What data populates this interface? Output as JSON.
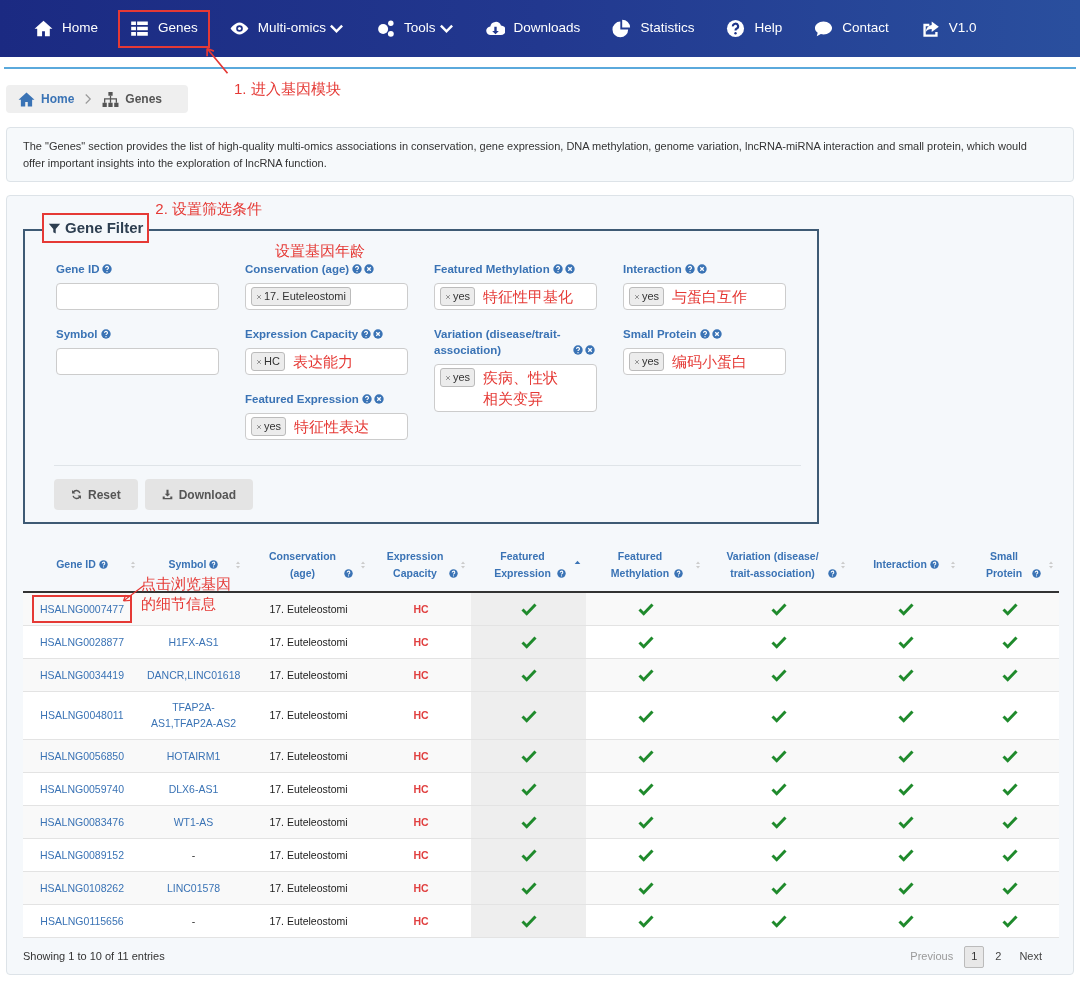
{
  "nav": {
    "items": [
      {
        "label": "Home",
        "dropdown": false,
        "highlighted": false
      },
      {
        "label": "Genes",
        "dropdown": false,
        "highlighted": true,
        "annotation": "1. 进入基因模块"
      },
      {
        "label": "Multi-omics",
        "dropdown": true,
        "highlighted": false
      },
      {
        "label": "Tools",
        "dropdown": true,
        "highlighted": false
      },
      {
        "label": "Downloads",
        "dropdown": false,
        "highlighted": false
      },
      {
        "label": "Statistics",
        "dropdown": false,
        "highlighted": false
      },
      {
        "label": "Help",
        "dropdown": false,
        "highlighted": false
      },
      {
        "label": "Contact",
        "dropdown": false,
        "highlighted": false
      },
      {
        "label": "V1.0",
        "dropdown": false,
        "highlighted": false
      }
    ]
  },
  "breadcrumb": [
    {
      "label": "Home"
    },
    {
      "label": "Genes"
    }
  ],
  "description": "The \"Genes\" section provides the list of high-quality multi-omics associations in conservation, gene expression, DNA methylation, genome variation, lncRNA-miRNA interaction and small protein, which would offer important insights into the exploration of lncRNA function.",
  "filter": {
    "title": "Gene Filter",
    "highlighted": true,
    "annotation": "2. 设置筛选条件",
    "columns": [
      [
        {
          "label": "Gene ID",
          "kind": "text",
          "clearable": false
        },
        {
          "label": "Symbol",
          "kind": "text",
          "clearable": false
        }
      ],
      [
        {
          "label": "Conservation (age)",
          "kind": "tags",
          "clearable": true,
          "tags": [
            "17. Euteleostomi"
          ],
          "annotation": "设置基因年龄"
        },
        {
          "label": "Expression Capacity",
          "kind": "tags",
          "clearable": true,
          "tags": [
            "HC"
          ],
          "note": "表达能力"
        },
        {
          "label": "Featured Expression",
          "kind": "tags",
          "clearable": true,
          "tags": [
            "yes"
          ],
          "note": "特征性表达"
        }
      ],
      [
        {
          "label": "Featured Methylation",
          "kind": "tags",
          "clearable": true,
          "tags": [
            "yes"
          ],
          "note": "特征性甲基化"
        },
        {
          "label": "Variation (disease/trait-association)",
          "kind": "tags",
          "clearable": true,
          "tags": [
            "yes"
          ],
          "note": "疾病、性状相关变异"
        }
      ],
      [
        {
          "label": "Interaction",
          "kind": "tags",
          "clearable": true,
          "tags": [
            "yes"
          ],
          "note": "与蛋白互作"
        },
        {
          "label": "Small Protein",
          "kind": "tags",
          "clearable": true,
          "tags": [
            "yes"
          ],
          "note": "编码小蛋白"
        }
      ]
    ],
    "buttons": [
      {
        "label": "Reset"
      },
      {
        "label": "Download"
      }
    ]
  },
  "table": {
    "columns": [
      {
        "label": "Gene ID",
        "sorted": false
      },
      {
        "label": "Symbol",
        "sorted": false
      },
      {
        "label": "Conservation (age)",
        "sorted": false
      },
      {
        "label": "Expression Capacity",
        "sorted": false
      },
      {
        "label": "Featured Expression",
        "sorted": true
      },
      {
        "label": "Featured Methylation",
        "sorted": false
      },
      {
        "label": "Variation (disease/ trait-association)",
        "sorted": false
      },
      {
        "label": "Interaction",
        "sorted": false
      },
      {
        "label": "Small Protein",
        "sorted": false
      }
    ],
    "rows": [
      {
        "gene_id": "HSALNG0007477",
        "highlighted": true,
        "annotation": "点击浏览基因的细节信息",
        "conservation": "17. Euteleostomi",
        "capacity": "HC",
        "featured_expression": true,
        "featured_methylation": true,
        "variation": true,
        "interaction": true,
        "small_protein": true
      },
      {
        "gene_id": "HSALNG0028877",
        "highlighted": false,
        "symbol": "H1FX-AS1",
        "conservation": "17. Euteleostomi",
        "capacity": "HC",
        "featured_expression": true,
        "featured_methylation": true,
        "variation": true,
        "interaction": true,
        "small_protein": true
      },
      {
        "gene_id": "HSALNG0034419",
        "highlighted": false,
        "symbol": "DANCR,LINC01618",
        "conservation": "17. Euteleostomi",
        "capacity": "HC",
        "featured_expression": true,
        "featured_methylation": true,
        "variation": true,
        "interaction": true,
        "small_protein": true
      },
      {
        "gene_id": "HSALNG0048011",
        "highlighted": false,
        "symbol": "TFAP2A-AS1,TFAP2A-AS2",
        "conservation": "17. Euteleostomi",
        "capacity": "HC",
        "featured_expression": true,
        "featured_methylation": true,
        "variation": true,
        "interaction": true,
        "small_protein": true
      },
      {
        "gene_id": "HSALNG0056850",
        "highlighted": false,
        "symbol": "HOTAIRM1",
        "conservation": "17. Euteleostomi",
        "capacity": "HC",
        "featured_expression": true,
        "featured_methylation": true,
        "variation": true,
        "interaction": true,
        "small_protein": true
      },
      {
        "gene_id": "HSALNG0059740",
        "highlighted": false,
        "symbol": "DLX6-AS1",
        "conservation": "17. Euteleostomi",
        "capacity": "HC",
        "featured_expression": true,
        "featured_methylation": true,
        "variation": true,
        "interaction": true,
        "small_protein": true
      },
      {
        "gene_id": "HSALNG0083476",
        "highlighted": false,
        "symbol": "WT1-AS",
        "conservation": "17. Euteleostomi",
        "capacity": "HC",
        "featured_expression": true,
        "featured_methylation": true,
        "variation": true,
        "interaction": true,
        "small_protein": true
      },
      {
        "gene_id": "HSALNG0089152",
        "highlighted": false,
        "symbol": "-",
        "conservation": "17. Euteleostomi",
        "capacity": "HC",
        "featured_expression": true,
        "featured_methylation": true,
        "variation": true,
        "interaction": true,
        "small_protein": true
      },
      {
        "gene_id": "HSALNG0108262",
        "highlighted": false,
        "symbol": "LINC01578",
        "conservation": "17. Euteleostomi",
        "capacity": "HC",
        "featured_expression": true,
        "featured_methylation": true,
        "variation": true,
        "interaction": true,
        "small_protein": true
      },
      {
        "gene_id": "HSALNG0115656",
        "highlighted": false,
        "symbol": "-",
        "conservation": "17. Euteleostomi",
        "capacity": "HC",
        "featured_expression": true,
        "featured_methylation": true,
        "variation": true,
        "interaction": true,
        "small_protein": true
      }
    ],
    "info": "Showing 1 to 10 of 11 entries",
    "pagination": [
      {
        "label": "Previous",
        "selected": false,
        "disabled": true
      },
      {
        "label": "1",
        "selected": true,
        "disabled": false
      },
      {
        "label": "2",
        "selected": false,
        "disabled": false
      },
      {
        "label": "Next",
        "selected": false,
        "disabled": false
      }
    ]
  }
}
